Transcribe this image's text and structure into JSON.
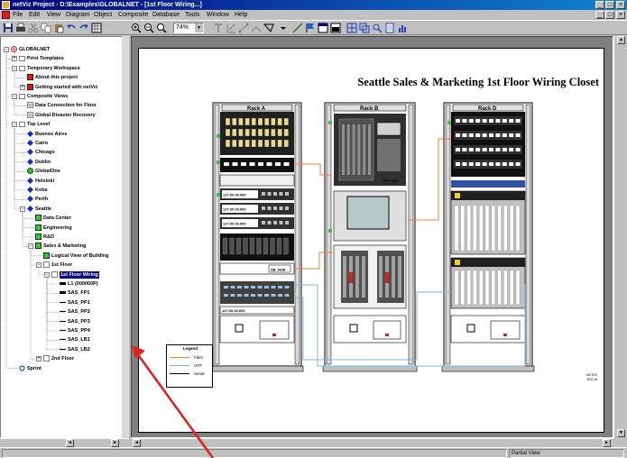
{
  "window": {
    "title": "netViz Project - D:\\Examples\\GLOBALNET - [1st Floor Wiring...]",
    "controls": [
      "_",
      "□",
      "×"
    ],
    "mdi_controls": [
      "_",
      "□",
      "×"
    ]
  },
  "menu": [
    "File",
    "Edit",
    "View",
    "Diagram",
    "Object",
    "Composite",
    "Database",
    "Tools",
    "Window",
    "Help"
  ],
  "toolbar": {
    "zoom_value": "74%"
  },
  "tree": [
    {
      "label": "GLOBALNET",
      "level": 0,
      "expander": "-",
      "icon": "globe-icon"
    },
    {
      "label": "Print Templates",
      "level": 1,
      "expander": "+",
      "icon": "folder-icon"
    },
    {
      "label": "Temporary Workspace",
      "level": 1,
      "expander": "-",
      "icon": "folder-icon"
    },
    {
      "label": "About this project",
      "level": 2,
      "expander": "",
      "icon": "red-doc-icon"
    },
    {
      "label": "Getting started with netViz",
      "level": 2,
      "expander": "+",
      "icon": "red-doc-icon"
    },
    {
      "label": "Composite Views",
      "level": 1,
      "expander": "-",
      "icon": "folder-icon"
    },
    {
      "label": "Data Connection for Floor",
      "level": 2,
      "expander": "",
      "icon": "doc-icon"
    },
    {
      "label": "Global Disaster Recovery",
      "level": 2,
      "expander": "",
      "icon": "doc-icon"
    },
    {
      "label": "Top Level",
      "level": 1,
      "expander": "-",
      "icon": "folder-icon"
    },
    {
      "label": "Buenos Aires",
      "level": 2,
      "expander": "",
      "icon": "blue-node-icon"
    },
    {
      "label": "Cairo",
      "level": 2,
      "expander": "",
      "icon": "blue-node-icon"
    },
    {
      "label": "Chicago",
      "level": 2,
      "expander": "",
      "icon": "blue-node-icon"
    },
    {
      "label": "Dublin",
      "level": 2,
      "expander": "",
      "icon": "blue-node-icon"
    },
    {
      "label": "GlobalOne",
      "level": 2,
      "expander": "",
      "icon": "green-node-icon"
    },
    {
      "label": "Helsinki",
      "level": 2,
      "expander": "",
      "icon": "blue-node-icon"
    },
    {
      "label": "Kobe",
      "level": 2,
      "expander": "",
      "icon": "blue-node-icon"
    },
    {
      "label": "Perth",
      "level": 2,
      "expander": "",
      "icon": "blue-node-icon"
    },
    {
      "label": "Seattle",
      "level": 2,
      "expander": "-",
      "icon": "blue-node-icon"
    },
    {
      "label": "Data Center",
      "level": 3,
      "expander": "",
      "icon": "green-box-icon"
    },
    {
      "label": "Engineering",
      "level": 3,
      "expander": "",
      "icon": "green-box-icon"
    },
    {
      "label": "R&D",
      "level": 3,
      "expander": "",
      "icon": "green-box-icon"
    },
    {
      "label": "Sales & Marketing",
      "level": 3,
      "expander": "-",
      "icon": "green-box-icon"
    },
    {
      "label": "Logical View of Building",
      "level": 4,
      "expander": "",
      "icon": "green-box-icon"
    },
    {
      "label": "1st Floor",
      "level": 4,
      "expander": "-",
      "icon": "white-box-icon"
    },
    {
      "label": "1st Floor Wiring",
      "level": 5,
      "expander": "-",
      "icon": "white-box-icon",
      "selected": true
    },
    {
      "label": "L1 (000000P)",
      "level": 6,
      "expander": "",
      "icon": "black-bar-icon"
    },
    {
      "label": "SAS_FP1",
      "level": 6,
      "expander": "",
      "icon": "black-bar-icon"
    },
    {
      "label": "SAS_PP1",
      "level": 6,
      "expander": "",
      "icon": "line-icon"
    },
    {
      "label": "SAS_PP2",
      "level": 6,
      "expander": "",
      "icon": "line-icon"
    },
    {
      "label": "SAS_PP3",
      "level": 6,
      "expander": "",
      "icon": "line-icon"
    },
    {
      "label": "SAS_PP4",
      "level": 6,
      "expander": "",
      "icon": "line-icon"
    },
    {
      "label": "SAS_LB1",
      "level": 6,
      "expander": "",
      "icon": "line-icon"
    },
    {
      "label": "SAS_LB2",
      "level": 6,
      "expander": "",
      "icon": "line-icon"
    },
    {
      "label": "2nd Floor",
      "level": 4,
      "expander": "+",
      "icon": "white-box-icon"
    },
    {
      "label": "Sprint",
      "level": 1,
      "expander": "",
      "icon": "blue-ring-icon"
    }
  ],
  "drawing": {
    "title": "Seattle Sales & Marketing 1st Floor Wiring Closet",
    "racks": [
      {
        "label": "Rack A"
      },
      {
        "label": "Rack B"
      },
      {
        "label": "Rack D"
      }
    ],
    "device_labels": {
      "rack_a_ip_1": "127.00.00.000",
      "rack_a_ip_2": "127.00.00.000",
      "rack_a_ip_3": "127.00.00.000",
      "rack_a_hub": "SB_HUB",
      "rack_a_bottom_ip": "127.00.00.000",
      "rack_b_server": "VPV_SW"
    },
    "legend": {
      "title": "Legend",
      "items": [
        {
          "label": "Fiber",
          "color": "#f08030"
        },
        {
          "label": "UTP",
          "color": "#80b0e0"
        },
        {
          "label": "Serial",
          "color": "#000000"
        }
      ]
    },
    "page_note": [
      "NOTES",
      "ESC=ft"
    ]
  },
  "colors": {
    "titlebar_start": "#000080",
    "titlebar_end": "#1084d0",
    "fiber": "#f08030",
    "utp": "#80b0e0",
    "green_module": "#40c040",
    "annotation_arrow": "#e02020"
  },
  "status": {
    "mode": "Partial View"
  },
  "scroll": {
    "left_arrow": "◄",
    "right_arrow": "►",
    "up_arrow": "▲",
    "down_arrow": "▼"
  }
}
